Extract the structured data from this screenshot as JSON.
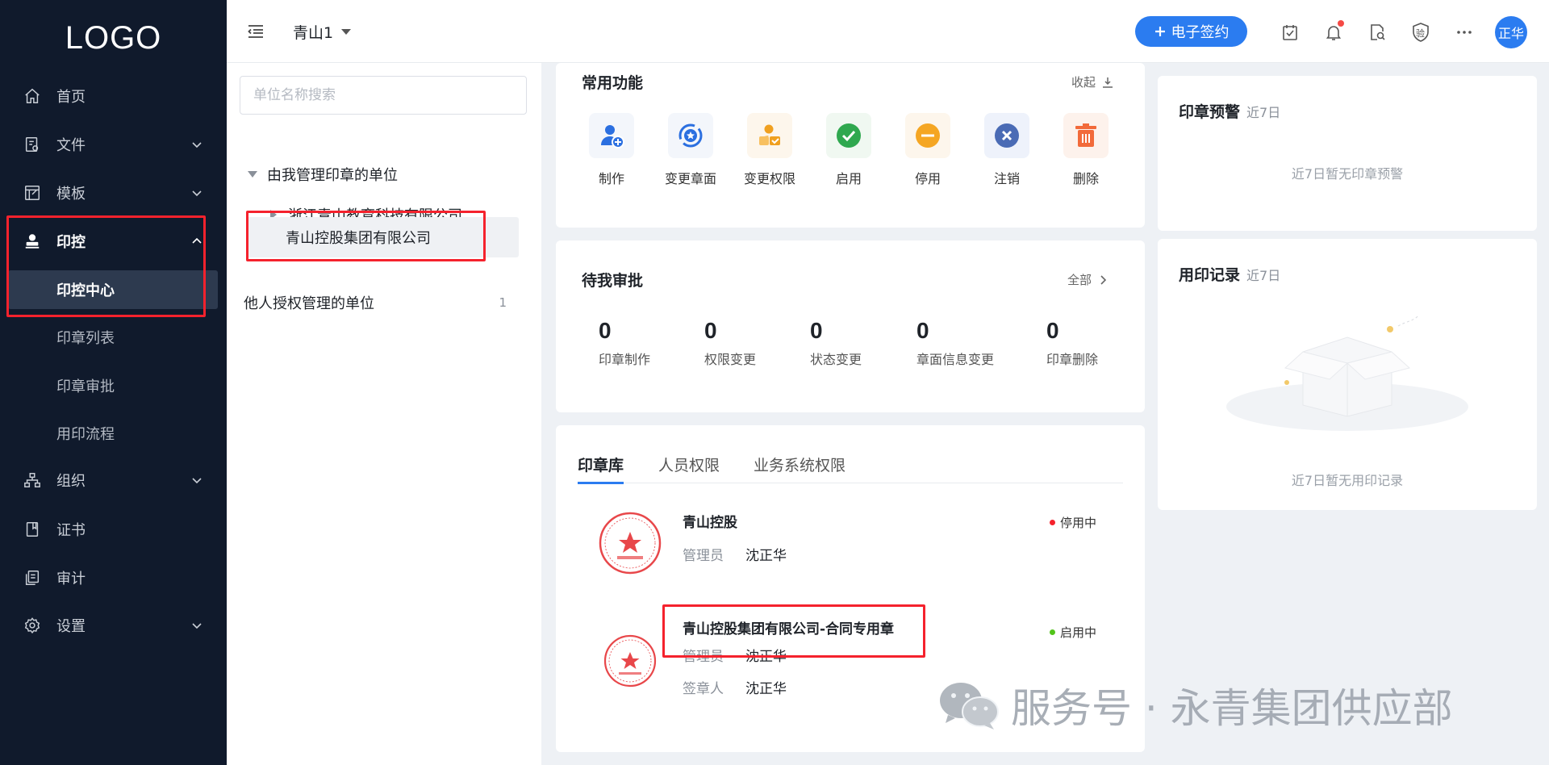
{
  "logo": "LOGO",
  "sidebar": {
    "items": [
      {
        "label": "首页",
        "icon": "home-icon"
      },
      {
        "label": "文件",
        "icon": "file-icon"
      },
      {
        "label": "模板",
        "icon": "template-icon"
      },
      {
        "label": "印控",
        "icon": "stamp-icon"
      },
      {
        "label": "组织",
        "icon": "org-icon"
      },
      {
        "label": "证书",
        "icon": "certificate-icon"
      },
      {
        "label": "审计",
        "icon": "audit-icon"
      },
      {
        "label": "设置",
        "icon": "gear-icon"
      }
    ],
    "sub": [
      "印控中心",
      "印章列表",
      "印章审批",
      "用印流程"
    ]
  },
  "topbar": {
    "org": "青山1",
    "esign_label": "电子签约",
    "avatar": "正华",
    "verify_icon_text": "验"
  },
  "tree": {
    "search_placeholder": "单位名称搜索",
    "group1": "由我管理印章的单位",
    "node1": "浙江青山教育科技有限公司",
    "node2": "青山控股集团有限公司",
    "group2": "他人授权管理的单位",
    "group2_count": "1"
  },
  "common": {
    "title": "常用功能",
    "collapse": "收起",
    "funcs": [
      {
        "label": "制作",
        "icon": "make-seal-icon"
      },
      {
        "label": "变更章面",
        "icon": "change-face-icon"
      },
      {
        "label": "变更权限",
        "icon": "change-permission-icon"
      },
      {
        "label": "启用",
        "icon": "enable-icon"
      },
      {
        "label": "停用",
        "icon": "disable-icon"
      },
      {
        "label": "注销",
        "icon": "cancel-icon"
      },
      {
        "label": "删除",
        "icon": "delete-icon"
      }
    ]
  },
  "approval": {
    "title": "待我审批",
    "all": "全部",
    "stats": [
      {
        "num": "0",
        "label": "印章制作"
      },
      {
        "num": "0",
        "label": "权限变更"
      },
      {
        "num": "0",
        "label": "状态变更"
      },
      {
        "num": "0",
        "label": "章面信息变更"
      },
      {
        "num": "0",
        "label": "印章删除"
      }
    ]
  },
  "library": {
    "tabs": [
      "印章库",
      "人员权限",
      "业务系统权限"
    ],
    "seals": [
      {
        "name": "青山控股",
        "status": "停用中",
        "status_color": "#f5222d",
        "rows": [
          {
            "k": "管理员",
            "v": "沈正华"
          }
        ]
      },
      {
        "name": "青山控股集团有限公司-合同专用章",
        "status": "启用中",
        "status_color": "#52c41a",
        "rows": [
          {
            "k": "管理员",
            "v": "沈正华"
          },
          {
            "k": "签章人",
            "v": "沈正华"
          }
        ]
      }
    ]
  },
  "warning": {
    "title": "印章预警",
    "sub": "近7日",
    "empty": "近7日暂无印章预警"
  },
  "records": {
    "title": "用印记录",
    "sub": "近7日",
    "empty": "近7日暂无用印记录"
  },
  "watermark": "服务号 · 永青集团供应部"
}
